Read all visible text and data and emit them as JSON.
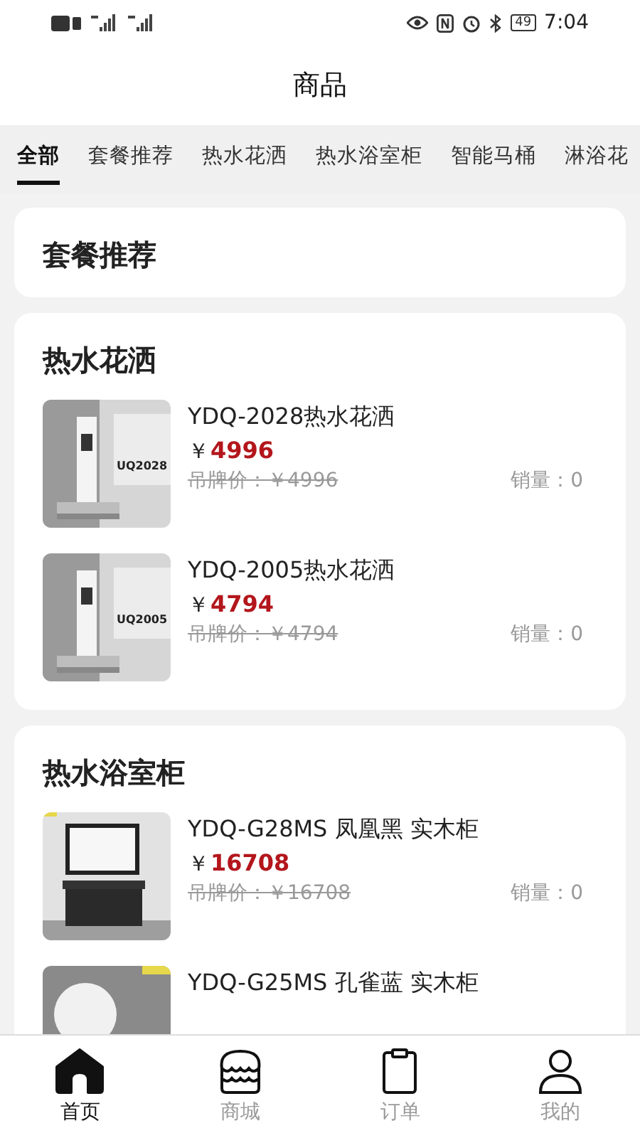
{
  "status_bar": {
    "battery": "49",
    "time": "7:04"
  },
  "header": {
    "title": "商品"
  },
  "tabs": [
    {
      "label": "全部",
      "selected": true
    },
    {
      "label": "套餐推荐",
      "selected": false
    },
    {
      "label": "热水花洒",
      "selected": false
    },
    {
      "label": "热水浴室柜",
      "selected": false
    },
    {
      "label": "智能马桶",
      "selected": false
    },
    {
      "label": "淋浴花",
      "selected": false
    }
  ],
  "sections": [
    {
      "title": "套餐推荐"
    },
    {
      "title": "热水花洒",
      "products": [
        {
          "kind": "shower",
          "image_label": "UQ2028",
          "name": "YDQ-2028热水花洒",
          "currency": "￥",
          "price": "4996",
          "list_price": "吊牌价：￥4996",
          "sales": "销量：0"
        },
        {
          "kind": "shower",
          "image_label": "UQ2005",
          "name": "YDQ-2005热水花洒",
          "currency": "￥",
          "price": "4794",
          "list_price": "吊牌价：￥4794",
          "sales": "销量：0"
        }
      ]
    },
    {
      "title": "热水浴室柜",
      "products": [
        {
          "kind": "cabinet",
          "name": "YDQ-G28MS 凤凰黑 实木柜",
          "currency": "￥",
          "price": "16708",
          "list_price": "吊牌价：￥16708",
          "sales": "销量：0"
        },
        {
          "kind": "round",
          "name": "YDQ-G25MS 孔雀蓝 实木柜"
        }
      ]
    }
  ],
  "bottom_nav": [
    {
      "label": "首页",
      "kind": "home",
      "selected": true
    },
    {
      "label": "商城",
      "kind": "shop",
      "selected": false
    },
    {
      "label": "订单",
      "kind": "order",
      "selected": false
    },
    {
      "label": "我的",
      "kind": "user",
      "selected": false
    }
  ]
}
